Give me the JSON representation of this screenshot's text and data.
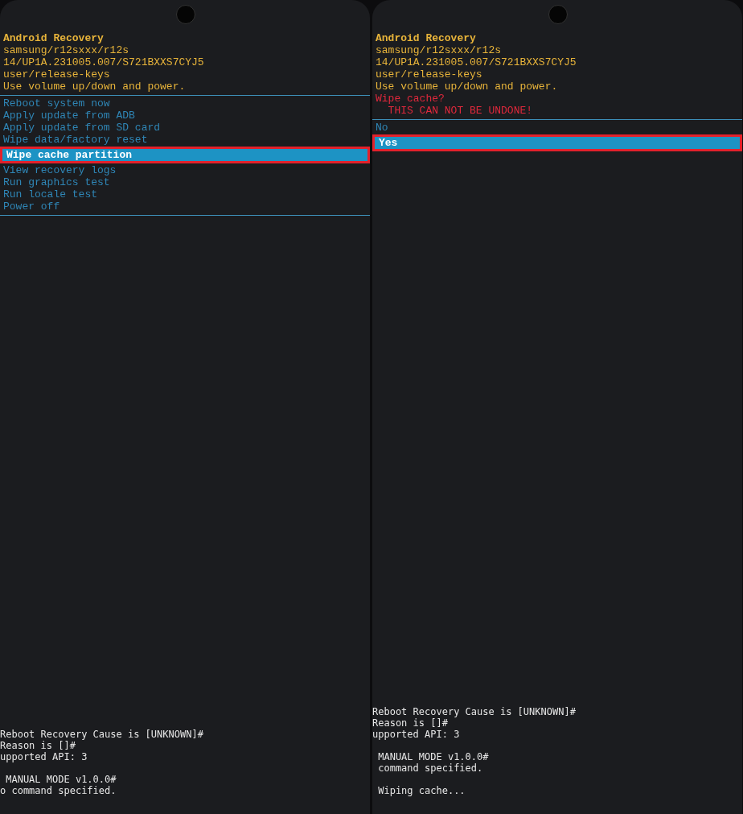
{
  "panels": [
    {
      "header": [
        "Android Recovery",
        "samsung/r12sxxx/r12s",
        "14/UP1A.231005.007/S721BXXS7CYJ5",
        "user/release-keys",
        "Use volume up/down and power."
      ],
      "menu": [
        {
          "label": "Reboot system now",
          "selected": false
        },
        {
          "label": "Apply update from ADB",
          "selected": false
        },
        {
          "label": "Apply update from SD card",
          "selected": false
        },
        {
          "label": "Wipe data/factory reset",
          "selected": false
        },
        {
          "label": "Wipe cache partition",
          "selected": true
        },
        {
          "label": "View recovery logs",
          "selected": false
        },
        {
          "label": "Run graphics test",
          "selected": false
        },
        {
          "label": "Run locale test",
          "selected": false
        },
        {
          "label": "Power off",
          "selected": false
        }
      ],
      "log_blocks": [
        [
          "Reboot Recovery Cause is [UNKNOWN]#",
          "Reason is []#",
          "upported API: 3"
        ],
        [
          " MANUAL MODE v1.0.0#",
          "o command specified."
        ]
      ]
    },
    {
      "header": [
        "Android Recovery",
        "samsung/r12sxxx/r12s",
        "14/UP1A.231005.007/S721BXXS7CYJ5",
        "user/release-keys",
        "Use volume up/down and power."
      ],
      "warning": [
        "Wipe cache?",
        "  THIS CAN NOT BE UNDONE!"
      ],
      "menu": [
        {
          "label": "No",
          "selected": false
        },
        {
          "label": "Yes",
          "selected": true
        }
      ],
      "log_blocks": [
        [
          "Reboot Recovery Cause is [UNKNOWN]#",
          "Reason is []#",
          "upported API: 3"
        ],
        [
          " MANUAL MODE v1.0.0#",
          " command specified."
        ],
        [
          " Wiping cache..."
        ]
      ]
    }
  ]
}
